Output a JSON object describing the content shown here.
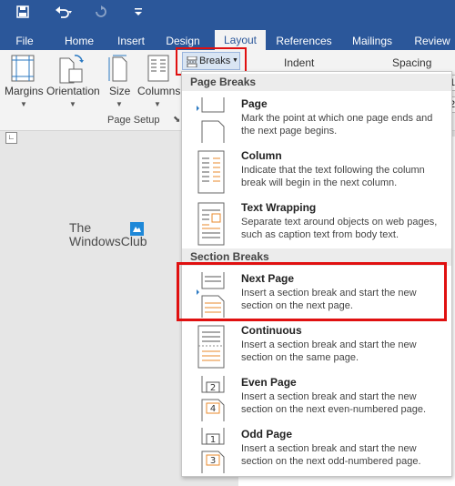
{
  "quick_access": {
    "save_icon": "save-icon",
    "undo_icon": "undo-icon",
    "redo_icon": "redo-icon",
    "customize_icon": "customize-qat-icon"
  },
  "tabs": [
    {
      "label": "File"
    },
    {
      "label": "Home"
    },
    {
      "label": "Insert"
    },
    {
      "label": "Design"
    },
    {
      "label": "Layout"
    },
    {
      "label": "References"
    },
    {
      "label": "Mailings"
    },
    {
      "label": "Review"
    }
  ],
  "ribbon": {
    "page_setup": {
      "buttons": [
        {
          "label": "Margins"
        },
        {
          "label": "Orientation"
        },
        {
          "label": "Size"
        },
        {
          "label": "Columns"
        }
      ],
      "breaks_label": "Breaks",
      "group_label": "Page Setup"
    },
    "paragraph": {
      "indent_label": "Indent",
      "spacing_label": "Spacing"
    }
  },
  "document": {
    "logo_line1": "The",
    "logo_line2": "WindowsClub"
  },
  "breaks_menu": {
    "page_breaks_header": "Page Breaks",
    "section_breaks_header": "Section Breaks",
    "page_breaks": [
      {
        "title": "Page",
        "description": "Mark the point at which one page ends and the next page begins."
      },
      {
        "title": "Column",
        "description": "Indicate that the text following the column break will begin in the next column."
      },
      {
        "title": "Text Wrapping",
        "description": "Separate text around objects on web pages, such as caption text from body text."
      }
    ],
    "section_breaks": [
      {
        "title": "Next Page",
        "description": "Insert a section break and start the new section on the next page."
      },
      {
        "title": "Continuous",
        "description": "Insert a section break and start the new section on the same page."
      },
      {
        "title": "Even Page",
        "description": "Insert a section break and start the new section on the next even-numbered page."
      },
      {
        "title": "Odd Page",
        "description": "Insert a section break and start the new section on the next odd-numbered page."
      }
    ]
  },
  "colors": {
    "title_bar": "#2b579a",
    "highlight": "#e01010",
    "icon_orange": "#e8892b"
  }
}
